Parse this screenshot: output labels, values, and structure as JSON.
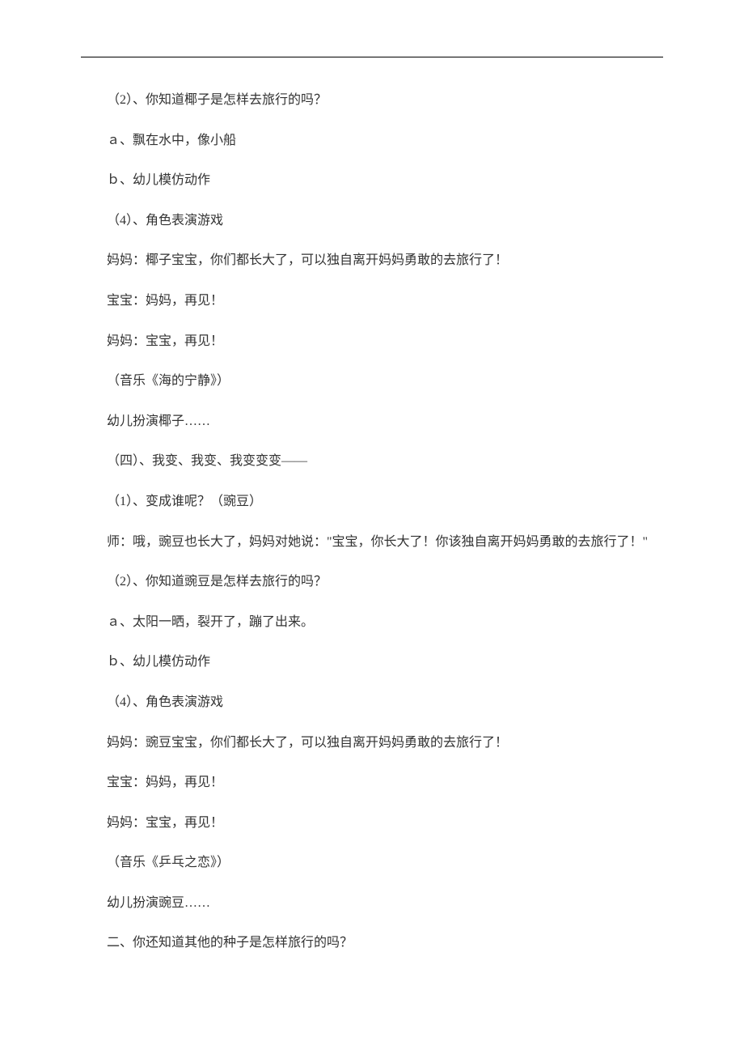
{
  "lines": [
    "（2）、你知道椰子是怎样去旅行的吗？",
    "ａ、飘在水中，像小船",
    "ｂ、幼儿模仿动作",
    "（4）、角色表演游戏",
    "妈妈：椰子宝宝，你们都长大了，可以独自离开妈妈勇敢的去旅行了！",
    "宝宝：妈妈，再见！",
    "妈妈：宝宝，再见！",
    "（音乐《海的宁静》）",
    "幼儿扮演椰子……",
    "（四）、我变、我变、我变变变——",
    "（1）、变成谁呢？（豌豆）",
    "师：哦，豌豆也长大了，妈妈对她说：\"宝宝，你长大了！你该独自离开妈妈勇敢的去旅行了！\"",
    "（2）、你知道豌豆是怎样去旅行的吗？",
    "ａ、太阳一晒，裂开了，蹦了出来。",
    "ｂ、幼儿模仿动作",
    "（4）、角色表演游戏",
    "妈妈：豌豆宝宝，你们都长大了，可以独自离开妈妈勇敢的去旅行了！",
    "宝宝：妈妈，再见！",
    "妈妈：宝宝，再见！",
    "（音乐《乒乓之恋》）",
    "幼儿扮演豌豆……",
    "二、你还知道其他的种子是怎样旅行的吗？"
  ]
}
